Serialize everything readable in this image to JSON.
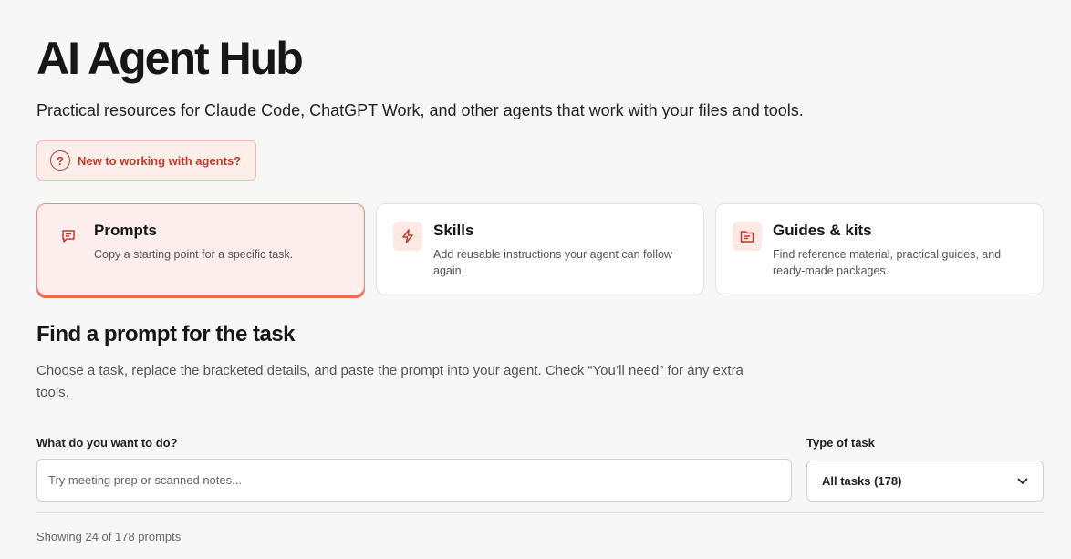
{
  "header": {
    "title": "AI Agent Hub",
    "subtitle": "Practical resources for Claude Code, ChatGPT Work, and other agents that work with your files and tools."
  },
  "help_button": {
    "label": "New to working with agents?",
    "icon": "question-circle-icon"
  },
  "cards": [
    {
      "title": "Prompts",
      "description": "Copy a starting point for a specific task.",
      "icon": "chat-lines-icon",
      "active": true
    },
    {
      "title": "Skills",
      "description": "Add reusable instructions your agent can follow again.",
      "icon": "lightning-icon",
      "active": false
    },
    {
      "title": "Guides & kits",
      "description": "Find reference material, practical guides, and ready-made packages.",
      "icon": "folder-document-icon",
      "active": false
    }
  ],
  "finder": {
    "heading": "Find a prompt for the task",
    "description": "Choose a task, replace the bracketed details, and paste the prompt into your agent. Check “You’ll need” for any extra tools.",
    "search_label": "What do you want to do?",
    "search_placeholder": "Try meeting prep or scanned notes...",
    "search_value": "",
    "type_label": "Type of task",
    "type_selected": "All tasks (178)"
  },
  "results": {
    "count_text": "Showing 24 of 178 prompts"
  },
  "colors": {
    "accent": "#c0392b",
    "accent_border": "#ee6a52",
    "card_active_bg": "#fdeeed",
    "page_bg": "#f7f7f7"
  }
}
